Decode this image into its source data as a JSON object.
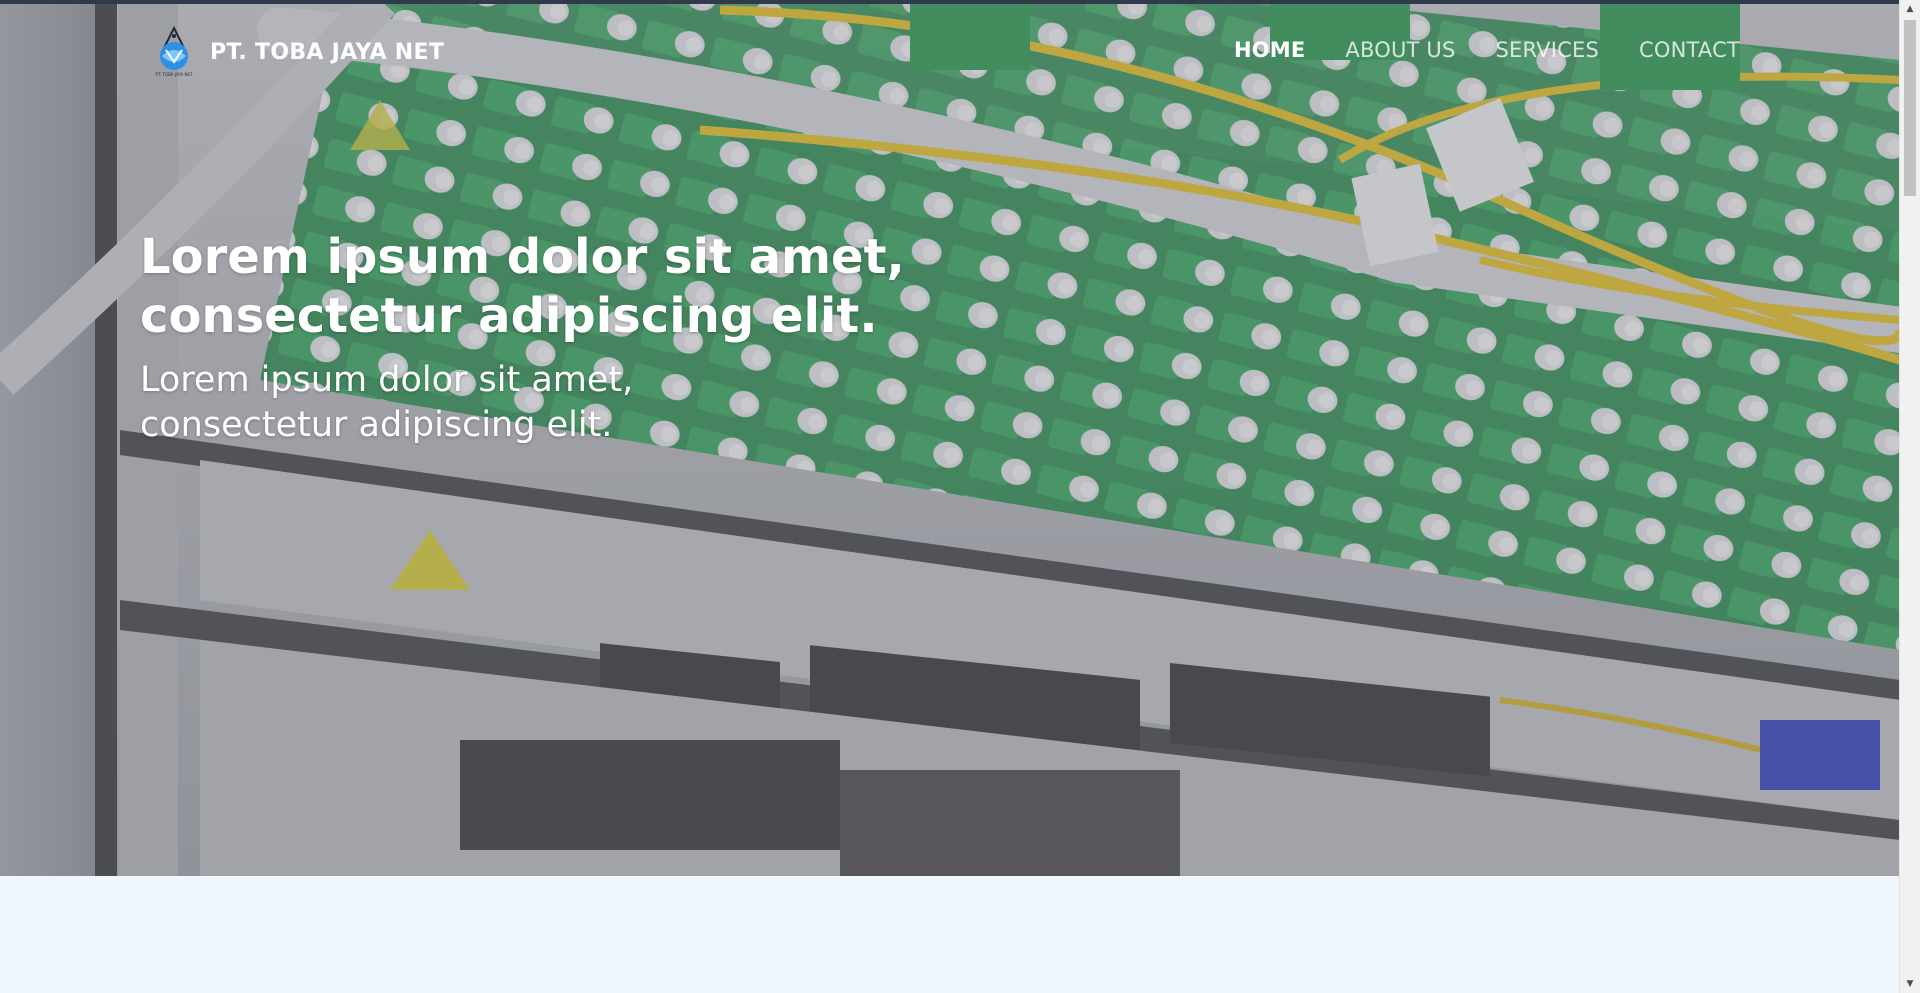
{
  "brand": {
    "name": "PT. TOBA JAYA NET",
    "logo_text": "PT. TOBA JAYA NET",
    "logo_icon": "network-globe-logo-icon"
  },
  "nav": {
    "items": [
      {
        "label": "HOME",
        "active": true
      },
      {
        "label": "ABOUT US",
        "active": false
      },
      {
        "label": "SERVICES",
        "active": false
      },
      {
        "label": "CONTACT",
        "active": false
      }
    ]
  },
  "hero": {
    "title_line1": "Lorem ipsum dolor sit amet,",
    "title_line2": "consectetur adipiscing elit.",
    "subtitle_line1": "Lorem ipsum dolor sit amet,",
    "subtitle_line2": "consectetur adipiscing elit.",
    "background": "fiber-optic-patch-panel-photo"
  },
  "colors": {
    "topline": "#2f3b4b",
    "section_bg": "#eff6fe",
    "text": "#ffffff",
    "green": "#1f9a4a",
    "yellow": "#e6c21a",
    "panel": "#b9bcc1"
  },
  "scrollbar": {
    "up_icon": "scroll-up-arrow-icon",
    "down_icon": "scroll-down-arrow-icon"
  }
}
